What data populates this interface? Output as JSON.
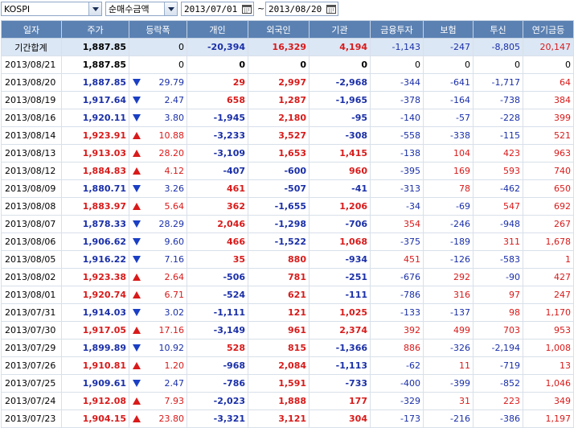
{
  "toolbar": {
    "market": "KOSPI",
    "metric": "순매수금액",
    "date_from": "2013/07/01",
    "separator": "~",
    "date_to": "2013/08/20"
  },
  "headers": [
    "일자",
    "주가",
    "등락폭",
    "개인",
    "외국인",
    "기관",
    "금융투자",
    "보험",
    "투신",
    "연기금등"
  ],
  "colors": {
    "header_bg": "#5b81b2",
    "up": "#d91a1a",
    "down": "#1a2fa8",
    "summary_bg": "#dce7f5"
  },
  "summary": {
    "label": "기간합계",
    "price": "1,887.85",
    "change": "0",
    "individual": "-20,394",
    "foreign": "16,329",
    "institution": "4,194",
    "fin_invest": "-1,143",
    "insurance": "-247",
    "trust": "-8,805",
    "pension": "20,147"
  },
  "rows": [
    {
      "date": "2013/08/21",
      "price": "1,887.85",
      "dir": "none",
      "change": "0",
      "individual": "0",
      "foreign": "0",
      "institution": "0",
      "fin_invest": "0",
      "insurance": "0",
      "trust": "0",
      "pension": "0"
    },
    {
      "date": "2013/08/20",
      "price": "1,887.85",
      "dir": "down",
      "change": "29.79",
      "individual": "29",
      "foreign": "2,997",
      "institution": "-2,968",
      "fin_invest": "-344",
      "insurance": "-641",
      "trust": "-1,717",
      "pension": "64"
    },
    {
      "date": "2013/08/19",
      "price": "1,917.64",
      "dir": "down",
      "change": "2.47",
      "individual": "658",
      "foreign": "1,287",
      "institution": "-1,965",
      "fin_invest": "-378",
      "insurance": "-164",
      "trust": "-738",
      "pension": "384"
    },
    {
      "date": "2013/08/16",
      "price": "1,920.11",
      "dir": "down",
      "change": "3.80",
      "individual": "-1,945",
      "foreign": "2,180",
      "institution": "-95",
      "fin_invest": "-140",
      "insurance": "-57",
      "trust": "-228",
      "pension": "399"
    },
    {
      "date": "2013/08/14",
      "price": "1,923.91",
      "dir": "up",
      "change": "10.88",
      "individual": "-3,233",
      "foreign": "3,527",
      "institution": "-308",
      "fin_invest": "-558",
      "insurance": "-338",
      "trust": "-115",
      "pension": "521"
    },
    {
      "date": "2013/08/13",
      "price": "1,913.03",
      "dir": "up",
      "change": "28.20",
      "individual": "-3,109",
      "foreign": "1,653",
      "institution": "1,415",
      "fin_invest": "-138",
      "insurance": "104",
      "trust": "423",
      "pension": "963"
    },
    {
      "date": "2013/08/12",
      "price": "1,884.83",
      "dir": "up",
      "change": "4.12",
      "individual": "-407",
      "foreign": "-600",
      "institution": "960",
      "fin_invest": "-395",
      "insurance": "169",
      "trust": "593",
      "pension": "740"
    },
    {
      "date": "2013/08/09",
      "price": "1,880.71",
      "dir": "down",
      "change": "3.26",
      "individual": "461",
      "foreign": "-507",
      "institution": "-41",
      "fin_invest": "-313",
      "insurance": "78",
      "trust": "-462",
      "pension": "650"
    },
    {
      "date": "2013/08/08",
      "price": "1,883.97",
      "dir": "up",
      "change": "5.64",
      "individual": "362",
      "foreign": "-1,655",
      "institution": "1,206",
      "fin_invest": "-34",
      "insurance": "-69",
      "trust": "547",
      "pension": "692"
    },
    {
      "date": "2013/08/07",
      "price": "1,878.33",
      "dir": "down",
      "change": "28.29",
      "individual": "2,046",
      "foreign": "-1,298",
      "institution": "-706",
      "fin_invest": "354",
      "insurance": "-246",
      "trust": "-948",
      "pension": "267"
    },
    {
      "date": "2013/08/06",
      "price": "1,906.62",
      "dir": "down",
      "change": "9.60",
      "individual": "466",
      "foreign": "-1,522",
      "institution": "1,068",
      "fin_invest": "-375",
      "insurance": "-189",
      "trust": "311",
      "pension": "1,678"
    },
    {
      "date": "2013/08/05",
      "price": "1,916.22",
      "dir": "down",
      "change": "7.16",
      "individual": "35",
      "foreign": "880",
      "institution": "-934",
      "fin_invest": "451",
      "insurance": "-126",
      "trust": "-583",
      "pension": "1"
    },
    {
      "date": "2013/08/02",
      "price": "1,923.38",
      "dir": "up",
      "change": "2.64",
      "individual": "-506",
      "foreign": "781",
      "institution": "-251",
      "fin_invest": "-676",
      "insurance": "292",
      "trust": "-90",
      "pension": "427"
    },
    {
      "date": "2013/08/01",
      "price": "1,920.74",
      "dir": "up",
      "change": "6.71",
      "individual": "-524",
      "foreign": "621",
      "institution": "-111",
      "fin_invest": "-786",
      "insurance": "316",
      "trust": "97",
      "pension": "247"
    },
    {
      "date": "2013/07/31",
      "price": "1,914.03",
      "dir": "down",
      "change": "3.02",
      "individual": "-1,111",
      "foreign": "121",
      "institution": "1,025",
      "fin_invest": "-133",
      "insurance": "-137",
      "trust": "98",
      "pension": "1,170"
    },
    {
      "date": "2013/07/30",
      "price": "1,917.05",
      "dir": "up",
      "change": "17.16",
      "individual": "-3,149",
      "foreign": "961",
      "institution": "2,374",
      "fin_invest": "392",
      "insurance": "499",
      "trust": "703",
      "pension": "953"
    },
    {
      "date": "2013/07/29",
      "price": "1,899.89",
      "dir": "down",
      "change": "10.92",
      "individual": "528",
      "foreign": "815",
      "institution": "-1,366",
      "fin_invest": "886",
      "insurance": "-326",
      "trust": "-2,194",
      "pension": "1,008"
    },
    {
      "date": "2013/07/26",
      "price": "1,910.81",
      "dir": "up",
      "change": "1.20",
      "individual": "-968",
      "foreign": "2,084",
      "institution": "-1,113",
      "fin_invest": "-62",
      "insurance": "11",
      "trust": "-719",
      "pension": "13"
    },
    {
      "date": "2013/07/25",
      "price": "1,909.61",
      "dir": "down",
      "change": "2.47",
      "individual": "-786",
      "foreign": "1,591",
      "institution": "-733",
      "fin_invest": "-400",
      "insurance": "-399",
      "trust": "-852",
      "pension": "1,046"
    },
    {
      "date": "2013/07/24",
      "price": "1,912.08",
      "dir": "up",
      "change": "7.93",
      "individual": "-2,023",
      "foreign": "1,888",
      "institution": "177",
      "fin_invest": "-329",
      "insurance": "31",
      "trust": "223",
      "pension": "349"
    },
    {
      "date": "2013/07/23",
      "price": "1,904.15",
      "dir": "up",
      "change": "23.80",
      "individual": "-3,321",
      "foreign": "3,121",
      "institution": "304",
      "fin_invest": "-173",
      "insurance": "-216",
      "trust": "-386",
      "pension": "1,197"
    }
  ]
}
